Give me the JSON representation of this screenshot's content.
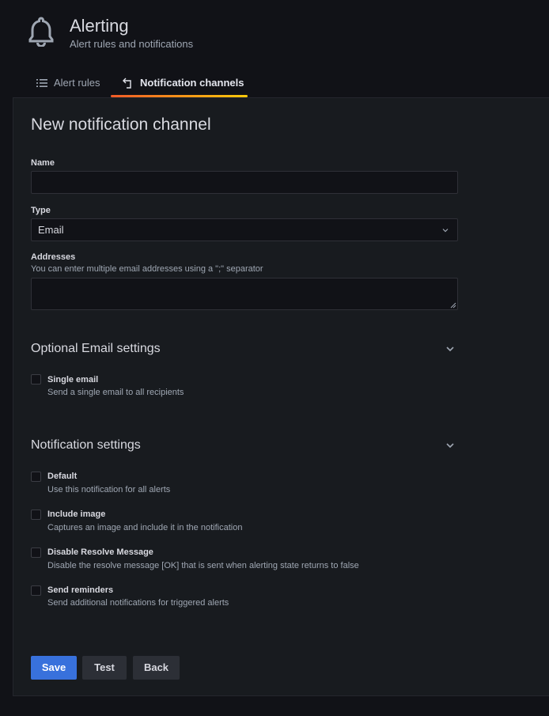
{
  "header": {
    "title": "Alerting",
    "subtitle": "Alert rules and notifications",
    "icon": "bell-icon"
  },
  "tabs": [
    {
      "label": "Alert rules",
      "icon": "list-icon",
      "active": false
    },
    {
      "label": "Notification channels",
      "icon": "channel-icon",
      "active": true
    }
  ],
  "form": {
    "heading": "New notification channel",
    "name": {
      "label": "Name",
      "value": ""
    },
    "type": {
      "label": "Type",
      "value": "Email"
    },
    "addresses": {
      "label": "Addresses",
      "description": "You can enter multiple email addresses using a \";\" separator",
      "value": ""
    }
  },
  "optional_section": {
    "title": "Optional Email settings",
    "items": [
      {
        "label": "Single email",
        "description": "Send a single email to all recipients",
        "checked": false
      }
    ]
  },
  "notification_section": {
    "title": "Notification settings",
    "items": [
      {
        "label": "Default",
        "description": "Use this notification for all alerts",
        "checked": false
      },
      {
        "label": "Include image",
        "description": "Captures an image and include it in the notification",
        "checked": false
      },
      {
        "label": "Disable Resolve Message",
        "description": "Disable the resolve message [OK] that is sent when alerting state returns to false",
        "checked": false
      },
      {
        "label": "Send reminders",
        "description": "Send additional notifications for triggered alerts",
        "checked": false
      }
    ]
  },
  "buttons": {
    "save": "Save",
    "test": "Test",
    "back": "Back"
  },
  "colors": {
    "background": "#111217",
    "panel": "#181b1f",
    "accent": "#f05a28",
    "primary_button": "#3871dc",
    "secondary_button": "#2c2f36"
  }
}
